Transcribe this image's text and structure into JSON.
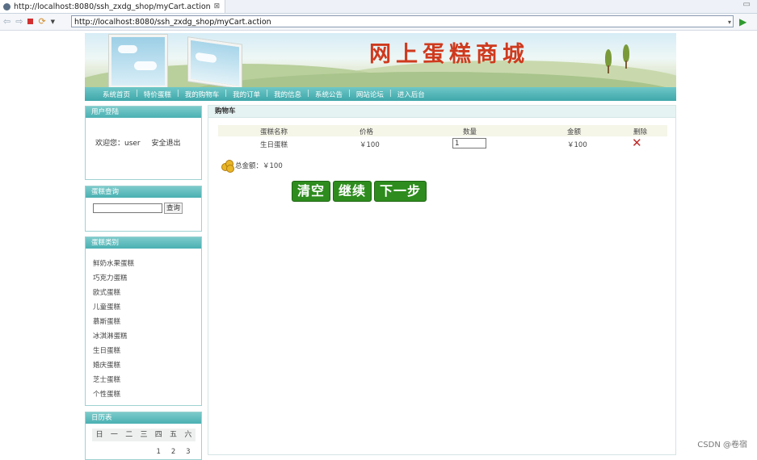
{
  "browser": {
    "tab_title": "http://localhost:8080/ssh_zxdg_shop/myCart.action",
    "tab_close": "⊠",
    "url": "http://localhost:8080/ssh_zxdg_shop/myCart.action"
  },
  "site": {
    "title": "网上蛋糕商城",
    "nav": [
      "系统首页",
      "特价蛋糕",
      "我的购物车",
      "我的订单",
      "我的信息",
      "系统公告",
      "网站论坛",
      "进入后台"
    ]
  },
  "sidebar": {
    "login": {
      "header": "用户登陆",
      "welcome": "欢迎您：user",
      "logout": "安全退出"
    },
    "search": {
      "header": "蛋糕查询",
      "value": "",
      "button": "查询"
    },
    "categories": {
      "header": "蛋糕类别",
      "items": [
        "鲜奶水果蛋糕",
        "巧克力蛋糕",
        "欧式蛋糕",
        "儿童蛋糕",
        "慕斯蛋糕",
        "冰淇淋蛋糕",
        "生日蛋糕",
        "婚庆蛋糕",
        "芝士蛋糕",
        "个性蛋糕"
      ]
    },
    "calendar": {
      "header": "日历表",
      "weekdays": [
        "日",
        "一",
        "二",
        "三",
        "四",
        "五",
        "六"
      ],
      "first_row": [
        "",
        "",
        "",
        "",
        "1",
        "2",
        "3"
      ]
    }
  },
  "cart": {
    "header": "购物车",
    "columns": {
      "name": "蛋糕名称",
      "price": "价格",
      "qty": "数量",
      "amount": "金额",
      "delete": "删除"
    },
    "rows": [
      {
        "name": "生日蛋糕",
        "price": "￥100",
        "qty": "1",
        "amount": "￥100"
      }
    ],
    "total_label": "总金额：￥100",
    "buttons": {
      "clear": "清空",
      "continue": "继续",
      "next": "下一步"
    }
  },
  "watermark": "CSDN @卷宿",
  "colors": {
    "nav": "#45aeb0",
    "title": "#cf3a1e",
    "button": "#2d8c1d",
    "delete": "#c02a2a"
  }
}
